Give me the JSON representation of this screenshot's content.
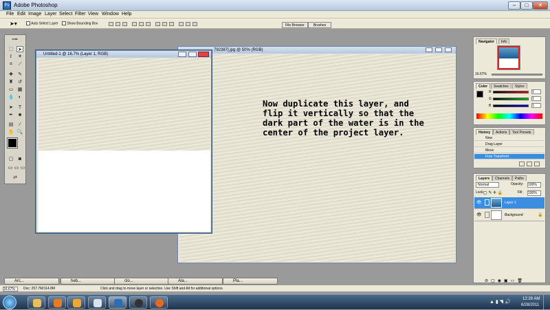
{
  "app": {
    "title": "Adobe Photoshop",
    "icon": "photoshop-icon"
  },
  "window_controls": {
    "minimize": "–",
    "maximize": "□",
    "close": "✕"
  },
  "menu": [
    "File",
    "Edit",
    "Image",
    "Layer",
    "Select",
    "Filter",
    "View",
    "Window",
    "Help"
  ],
  "options_bar": {
    "auto_select": "Auto Select Layer",
    "bounding_box": "Show Bounding Box",
    "workspace_tabs": [
      "File Browser",
      "Brushes"
    ]
  },
  "documents": {
    "doc1": {
      "title": "Untitled-1 @ 16.7% (Layer 1, RGB)"
    },
    "doc2": {
      "title": "792387].jpg @ 50% (RGB)"
    }
  },
  "caption": {
    "line1": "Now duplicate this layer, and",
    "line2": "flip it vertically so that the",
    "line3": "dark part of the water is in the",
    "line4": "center of the project layer."
  },
  "navigator": {
    "tabs": [
      "Navigator",
      "Info"
    ],
    "zoom": "16.67%"
  },
  "color": {
    "tabs": [
      "Color",
      "Swatches",
      "Styles"
    ],
    "r_label": "R",
    "g_label": "G",
    "b_label": "B",
    "r": "1",
    "g": "1",
    "b": "1"
  },
  "history": {
    "tabs": [
      "History",
      "Actions",
      "Tool Presets"
    ],
    "items": [
      "New",
      "Drag Layer",
      "Move",
      "Free Transform"
    ],
    "selected_index": 3
  },
  "layers": {
    "tabs": [
      "Layers",
      "Channels",
      "Paths"
    ],
    "blend_mode": "Normal",
    "opacity_label": "Opacity:",
    "opacity": "100%",
    "lock_label": "Lock:",
    "fill_label": "Fill:",
    "fill": "100%",
    "items": [
      {
        "name": "Layer 1",
        "selected": true
      },
      {
        "name": "Background",
        "selected": false
      }
    ]
  },
  "minimized_docs": [
    "Arc...",
    "heb...",
    "clo...",
    "Ala...",
    "Pla..."
  ],
  "status": {
    "zoom": "16.67%",
    "doc": "Doc: 257.7M/114.8M",
    "hint": "Click and drag to move layer or selection. Use Shift and Alt for additional options."
  },
  "taskbar": {
    "apps": [
      "start-orb",
      "windows-explorer",
      "media-player",
      "paint-icon",
      "photoshop-task",
      "disc-app",
      "firefox-icon"
    ],
    "time": "12:28 AM",
    "date": "6/28/2011"
  },
  "colors": {
    "accent_selected": "#3a8de0",
    "title_gradient_top": "#dbe6f3",
    "panel_bg": "#ece9d8",
    "fg_color": "#000000",
    "bg_color": "#3ea2d8"
  }
}
